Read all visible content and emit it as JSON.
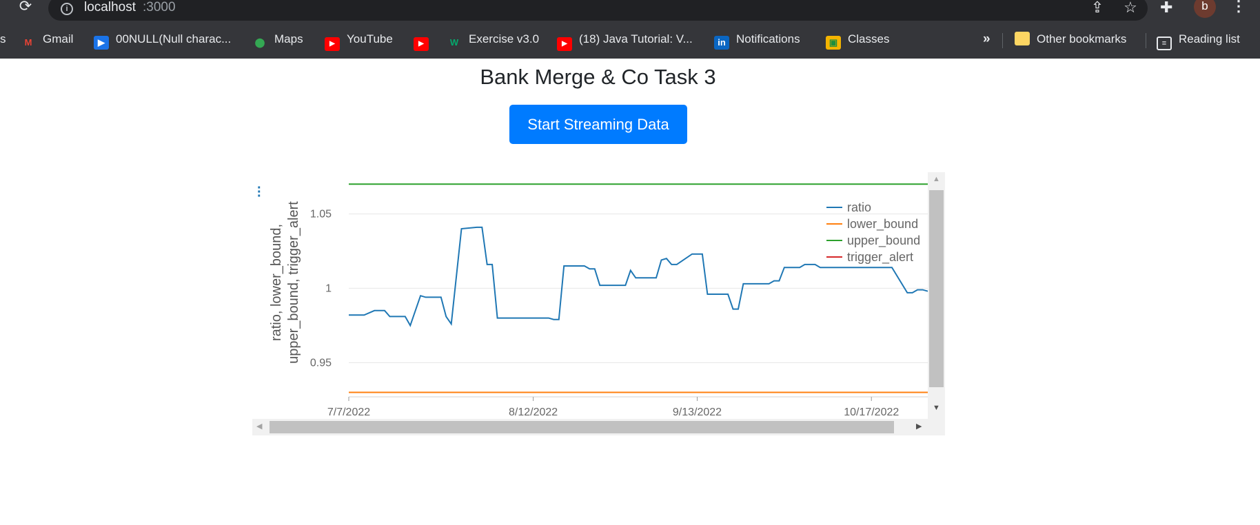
{
  "browser": {
    "url_host": "localhost",
    "url_port": ":3000",
    "avatar_letter": "b",
    "bookmarks": [
      {
        "label": "s",
        "icon": ""
      },
      {
        "label": "Gmail",
        "icon": "gmail-icon"
      },
      {
        "label": "00NULL(Null charac...",
        "icon": "video-play-icon"
      },
      {
        "label": "Maps",
        "icon": "maps-pin-icon"
      },
      {
        "label": "YouTube",
        "icon": "youtube-icon"
      },
      {
        "label": "",
        "icon": "youtube-icon"
      },
      {
        "label": "Exercise v3.0",
        "icon": "w3schools-icon"
      },
      {
        "label": "(18) Java Tutorial: V...",
        "icon": "youtube-icon"
      },
      {
        "label": "Notifications",
        "icon": "linkedin-icon"
      },
      {
        "label": "Classes",
        "icon": "google-classroom-icon"
      }
    ],
    "overflow_label": "»",
    "other_bookmarks": "Other bookmarks",
    "reading_list": "Reading list"
  },
  "page": {
    "title": "Bank Merge & Co Task 3",
    "button_label": "Start Streaming Data"
  },
  "chart_data": {
    "type": "line",
    "title": "",
    "xlabel": "",
    "ylabel": "ratio, lower_bound, upper_bound, trigger_alert",
    "ylabel_lines": [
      "ratio, lower_bound,",
      "upper_bound, trigger_alert"
    ],
    "x_ticks": [
      "7/7/2022",
      "8/12/2022",
      "9/13/2022",
      "10/17/2022"
    ],
    "y_ticks": [
      "1.05",
      "1",
      "0.95"
    ],
    "ylim": [
      0.927,
      1.078
    ],
    "grid": true,
    "legend_position": "top-right",
    "colors": {
      "ratio": "#1f77b4",
      "lower_bound": "#ff7f0e",
      "upper_bound": "#2ca02c",
      "trigger_alert": "#d62728"
    },
    "series": [
      {
        "name": "ratio",
        "x": [
          "2022-07-07",
          "2022-07-10",
          "2022-07-12",
          "2022-07-14",
          "2022-07-15",
          "2022-07-18",
          "2022-07-19",
          "2022-07-21",
          "2022-07-22",
          "2022-07-25",
          "2022-07-26",
          "2022-07-27",
          "2022-07-29",
          "2022-08-01",
          "2022-08-02",
          "2022-08-03",
          "2022-08-04",
          "2022-08-05",
          "2022-08-08",
          "2022-08-09",
          "2022-08-10",
          "2022-08-11",
          "2022-08-12",
          "2022-08-15",
          "2022-08-16",
          "2022-08-17",
          "2022-08-18",
          "2022-08-19",
          "2022-08-22",
          "2022-08-23",
          "2022-08-24",
          "2022-08-25",
          "2022-08-26",
          "2022-08-29",
          "2022-08-30",
          "2022-08-31",
          "2022-09-01",
          "2022-09-02",
          "2022-09-05",
          "2022-09-06",
          "2022-09-07",
          "2022-09-08",
          "2022-09-09",
          "2022-09-12",
          "2022-09-13",
          "2022-09-14",
          "2022-09-15",
          "2022-09-16",
          "2022-09-19",
          "2022-09-20",
          "2022-09-21",
          "2022-09-22",
          "2022-09-23",
          "2022-09-26",
          "2022-09-27",
          "2022-09-28",
          "2022-09-29",
          "2022-09-30",
          "2022-10-03",
          "2022-10-04",
          "2022-10-05",
          "2022-10-06",
          "2022-10-07",
          "2022-10-10",
          "2022-10-11",
          "2022-10-12",
          "2022-10-13",
          "2022-10-14",
          "2022-10-17",
          "2022-10-18",
          "2022-10-19",
          "2022-10-20",
          "2022-10-21",
          "2022-10-24",
          "2022-10-25",
          "2022-10-26",
          "2022-10-27",
          "2022-10-28"
        ],
        "y": [
          0.982,
          0.982,
          0.985,
          0.985,
          0.981,
          0.981,
          0.975,
          0.995,
          0.994,
          0.994,
          0.981,
          0.976,
          1.04,
          1.041,
          1.041,
          1.016,
          1.016,
          0.98,
          0.98,
          0.98,
          0.98,
          0.98,
          0.98,
          0.98,
          0.979,
          0.979,
          1.015,
          1.015,
          1.015,
          1.013,
          1.013,
          1.002,
          1.002,
          1.002,
          1.002,
          1.012,
          1.007,
          1.007,
          1.007,
          1.019,
          1.02,
          1.016,
          1.016,
          1.023,
          1.023,
          1.023,
          0.996,
          0.996,
          0.996,
          0.986,
          0.986,
          1.003,
          1.003,
          1.003,
          1.003,
          1.005,
          1.005,
          1.014,
          1.014,
          1.016,
          1.016,
          1.016,
          1.014,
          1.014,
          1.014,
          1.014,
          1.014,
          1.014,
          1.014,
          1.014,
          1.014,
          1.014,
          1.014,
          0.997,
          0.997,
          0.999,
          0.999,
          0.998
        ]
      },
      {
        "name": "lower_bound",
        "x": [
          "2022-07-07",
          "2022-10-28"
        ],
        "y": [
          0.93,
          0.93
        ]
      },
      {
        "name": "upper_bound",
        "x": [
          "2022-07-07",
          "2022-10-28"
        ],
        "y": [
          1.07,
          1.07
        ]
      },
      {
        "name": "trigger_alert",
        "x": [],
        "y": []
      }
    ]
  }
}
